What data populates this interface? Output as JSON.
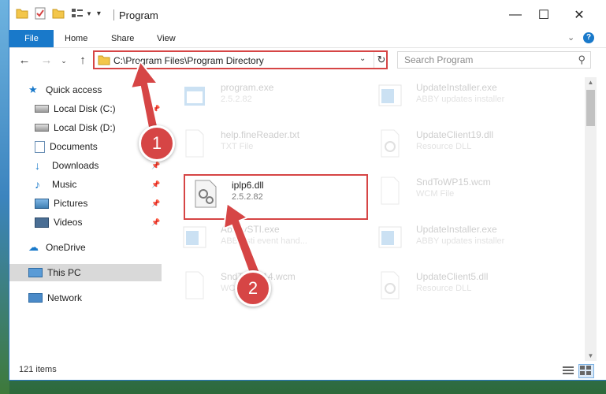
{
  "window": {
    "title": "Program",
    "controls": {
      "minimize": "—",
      "maximize": "☐",
      "close": "✕"
    }
  },
  "ribbon": {
    "tabs": [
      {
        "label": "File"
      },
      {
        "label": "Home"
      },
      {
        "label": "Share"
      },
      {
        "label": "View"
      }
    ],
    "expand_icon": "chevron-down-icon",
    "help_icon": "help-icon"
  },
  "navigation": {
    "path": "C:\\Program Files\\Program Directory",
    "search_placeholder": "Search Program"
  },
  "sidebar": {
    "items": [
      {
        "label": "Quick access",
        "icon": "star-icon"
      },
      {
        "label": "Local Disk (C:)",
        "icon": "drive-icon"
      },
      {
        "label": "Local Disk (D:)",
        "icon": "drive-icon"
      },
      {
        "label": "Documents",
        "icon": "documents-icon"
      },
      {
        "label": "Downloads",
        "icon": "download-icon"
      },
      {
        "label": "Music",
        "icon": "music-icon"
      },
      {
        "label": "Pictures",
        "icon": "pictures-icon"
      },
      {
        "label": "Videos",
        "icon": "videos-icon"
      },
      {
        "label": "OneDrive",
        "icon": "cloud-icon"
      },
      {
        "label": "This PC",
        "icon": "computer-icon"
      },
      {
        "label": "Network",
        "icon": "network-icon"
      }
    ]
  },
  "files": [
    {
      "name": "program.exe",
      "meta": "2.5.2.82",
      "icon": "exe-icon"
    },
    {
      "name": "UpdateInstaller.exe",
      "meta": "ABBY updates installer",
      "icon": "exe-icon"
    },
    {
      "name": "help.fineReader.txt",
      "meta": "TXT File",
      "icon": "text-file-icon"
    },
    {
      "name": "UpdateClient19.dll",
      "meta": "Resource DLL",
      "icon": "dll-icon"
    },
    {
      "name": "iplp6.dll",
      "meta": "2.5.2.82",
      "icon": "dll-gear-icon"
    },
    {
      "name": "SndToWP15.wcm",
      "meta": "WCM File",
      "icon": "text-file-icon"
    },
    {
      "name": "AbbyySTI.exe",
      "meta": "ABBY sti event hand...",
      "icon": "exe-icon"
    },
    {
      "name": "UpdateInstaller.exe",
      "meta": "ABBY updates installer",
      "icon": "exe-icon"
    },
    {
      "name": "SndToWP14.wcm",
      "meta": "WCM File",
      "icon": "text-file-icon"
    },
    {
      "name": "UpdateClient5.dll",
      "meta": "Resource DLL",
      "icon": "dll-icon"
    }
  ],
  "status": {
    "count": "121 items"
  },
  "callouts": {
    "one": "1",
    "two": "2"
  },
  "colors": {
    "accent": "#1979ca",
    "highlight": "#d64545"
  }
}
